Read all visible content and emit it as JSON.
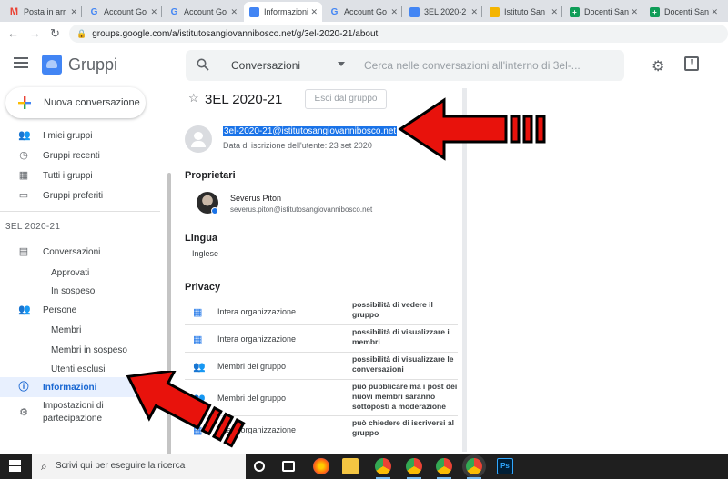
{
  "browser": {
    "tabs": [
      {
        "label": "Posta in arr",
        "icon": "gmail-icon",
        "color": "#ea4335"
      },
      {
        "label": "Account Go",
        "icon": "google-icon",
        "color": "#4285f4"
      },
      {
        "label": "Account Go",
        "icon": "google-icon",
        "color": "#4285f4"
      },
      {
        "label": "Informazioni",
        "icon": "groups-icon",
        "color": "#4285f4"
      },
      {
        "label": "Account Go",
        "icon": "google-icon",
        "color": "#4285f4"
      },
      {
        "label": "3EL 2020-2",
        "icon": "docs-icon",
        "color": "#4285f4"
      },
      {
        "label": "Istituto San",
        "icon": "school-icon",
        "color": "#f4b400"
      },
      {
        "label": "Docenti San",
        "icon": "sheets-icon",
        "color": "#0f9d58"
      },
      {
        "label": "Docenti San",
        "icon": "sheets-icon",
        "color": "#0f9d58"
      }
    ],
    "url": "groups.google.com/a/istitutosangiovannibosco.net/g/3el-2020-21/about"
  },
  "header": {
    "app_title": "Gruppi",
    "search_scope": "Conversazioni",
    "search_placeholder": "Cerca nelle conversazioni all'interno di 3el-..."
  },
  "sidebar": {
    "new_button": "Nuova conversazione",
    "top_items": [
      {
        "label": "I miei gruppi",
        "icon": "people-icon"
      },
      {
        "label": "Gruppi recenti",
        "icon": "clock-icon"
      },
      {
        "label": "Tutti i gruppi",
        "icon": "building-icon"
      },
      {
        "label": "Gruppi preferiti",
        "icon": "folder-star-icon"
      }
    ],
    "section_title": "3EL 2020-21",
    "conversations": "Conversazioni",
    "approved": "Approvati",
    "pending": "In sospeso",
    "people": "Persone",
    "members": "Membri",
    "members_pending": "Membri in sospeso",
    "excluded": "Utenti esclusi",
    "info": "Informazioni",
    "settings_line1": "Impostazioni di",
    "settings_line2": "partecipazione"
  },
  "main": {
    "title": "3EL 2020-21",
    "leave_button": "Esci dal gruppo",
    "group_email": "3el-2020-21@istitutosangiovannibosco.net",
    "joined": "Data di iscrizione dell'utente: 23 set 2020",
    "owners_title": "Proprietari",
    "owner_name": "Severus Piton",
    "owner_email": "severus.piton@istitutosangiovannibosco.net",
    "language_title": "Lingua",
    "language_value": "Inglese",
    "privacy_title": "Privacy",
    "privacy": [
      {
        "who": "Intera organizzazione",
        "what": "possibilità di vedere il gruppo",
        "icon": "building-icon"
      },
      {
        "who": "Intera organizzazione",
        "what": "possibilità di visualizzare i membri",
        "icon": "building-icon"
      },
      {
        "who": "Membri del gruppo",
        "what": "possibilità di visualizzare le conversazioni",
        "icon": "people-icon"
      },
      {
        "who": "Membri del gruppo",
        "what": "può pubblicare ma i post dei nuovi membri saranno sottoposti a moderazione",
        "icon": "people-icon"
      },
      {
        "who": "Intera organizzazione",
        "what": "può chiedere di iscriversi al gruppo",
        "icon": "building-icon"
      }
    ]
  },
  "taskbar": {
    "search_text": "Scrivi qui per eseguire la ricerca",
    "photoshop_label": "Ps"
  },
  "colors": {
    "accent": "#1a73e8",
    "active_bg": "#e8f0fe",
    "arrow_red": "#e8120c"
  }
}
